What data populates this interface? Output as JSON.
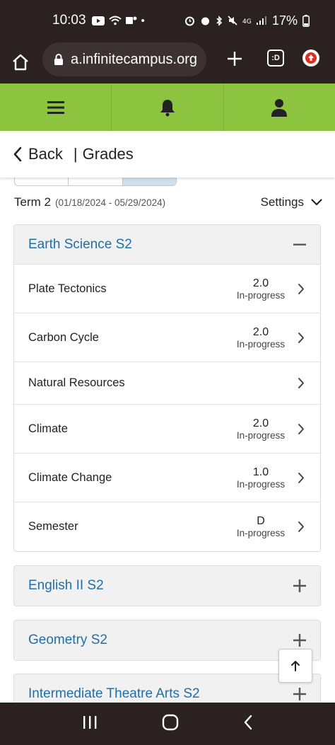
{
  "status_bar": {
    "time": "10:03",
    "battery": "17%"
  },
  "browser": {
    "url": "a.infinitecampus.org",
    "tab_count": ":D"
  },
  "header": {
    "back_label": "Back",
    "separator": "|",
    "title": "Grades"
  },
  "term": {
    "name": "Term 2",
    "dates": "(01/18/2024 - 05/29/2024)",
    "settings_label": "Settings"
  },
  "courses": [
    {
      "title": "Earth Science S2",
      "expanded": true,
      "tasks": [
        {
          "name": "Plate Tectonics",
          "score": "2.0",
          "status": "In-progress"
        },
        {
          "name": "Carbon Cycle",
          "score": "2.0",
          "status": "In-progress"
        },
        {
          "name": "Natural Resources",
          "score": "",
          "status": ""
        },
        {
          "name": "Climate",
          "score": "2.0",
          "status": "In-progress"
        },
        {
          "name": "Climate Change",
          "score": "1.0",
          "status": "In-progress"
        },
        {
          "name": "Semester",
          "score": "D",
          "status": "In-progress"
        }
      ]
    },
    {
      "title": "English II S2",
      "expanded": false
    },
    {
      "title": "Geometry S2",
      "expanded": false
    },
    {
      "title": "Intermediate Theatre Arts S2",
      "expanded": false
    }
  ],
  "icons": {
    "home": "home-icon",
    "lock": "lock-icon",
    "menu": "hamburger-menu-icon",
    "bell": "bell-icon",
    "user": "user-icon",
    "back": "chevron-left-icon",
    "settings_chevron": "chevron-down-icon",
    "row_chevron": "chevron-right-icon",
    "scroll_top": "arrow-up-icon"
  },
  "colors": {
    "nav_green": "#8cc43f",
    "course_link": "#1f6fa8",
    "chrome_dark": "#2b2121"
  }
}
